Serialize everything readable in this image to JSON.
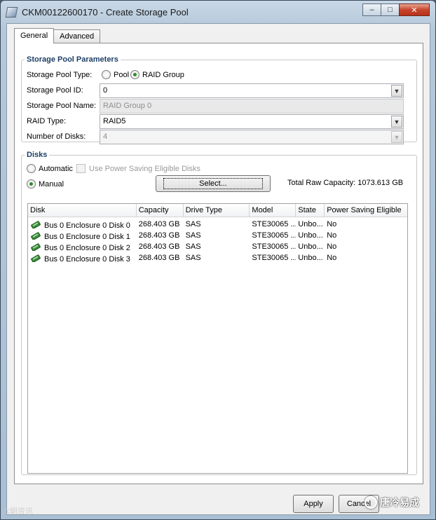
{
  "window": {
    "title": "CKM00122600170 - Create Storage Pool",
    "caption_buttons": {
      "minimize": "–",
      "maximize": "□",
      "close": "✕"
    }
  },
  "tabs": [
    {
      "label": "General",
      "active": true
    },
    {
      "label": "Advanced",
      "active": false
    }
  ],
  "parameters": {
    "legend": "Storage Pool Parameters",
    "pool_type_label": "Storage Pool Type:",
    "pool_type_options": [
      {
        "label": "Pool",
        "selected": false
      },
      {
        "label": "RAID Group",
        "selected": true
      }
    ],
    "pool_id_label": "Storage Pool ID:",
    "pool_id_value": "0",
    "pool_name_label": "Storage Pool Name:",
    "pool_name_value": "RAID Group 0",
    "raid_type_label": "RAID Type:",
    "raid_type_value": "RAID5",
    "num_disks_label": "Number of Disks:",
    "num_disks_value": "4"
  },
  "disks": {
    "legend": "Disks",
    "automatic_label": "Automatic",
    "power_saving_label": "Use Power Saving Eligible Disks",
    "manual_label": "Manual",
    "select_button": "Select...",
    "total_capacity": "Total Raw Capacity: 1073.613 GB",
    "columns": [
      "Disk",
      "Capacity",
      "Drive Type",
      "Model",
      "State",
      "Power Saving Eligible"
    ],
    "rows": [
      [
        "Bus 0 Enclosure 0 Disk 0",
        "268.403 GB",
        "SAS",
        "STE30065 ...",
        "Unbo...",
        "No"
      ],
      [
        "Bus 0 Enclosure 0 Disk 1",
        "268.403 GB",
        "SAS",
        "STE30065 ...",
        "Unbo...",
        "No"
      ],
      [
        "Bus 0 Enclosure 0 Disk 2",
        "268.403 GB",
        "SAS",
        "STE30065 ...",
        "Unbo...",
        "No"
      ],
      [
        "Bus 0 Enclosure 0 Disk 3",
        "268.403 GB",
        "SAS",
        "STE30065 ...",
        "Unbo...",
        "No"
      ]
    ]
  },
  "buttons": {
    "apply": "Apply",
    "cancel": "Cancel"
  },
  "watermarks": {
    "left": "六朝资讯",
    "right": "唐冷易成"
  },
  "colors": {
    "legend": "#1e3f66",
    "radio_selected": "#2d8c2d",
    "disk_icon": "#3a8a3a"
  }
}
